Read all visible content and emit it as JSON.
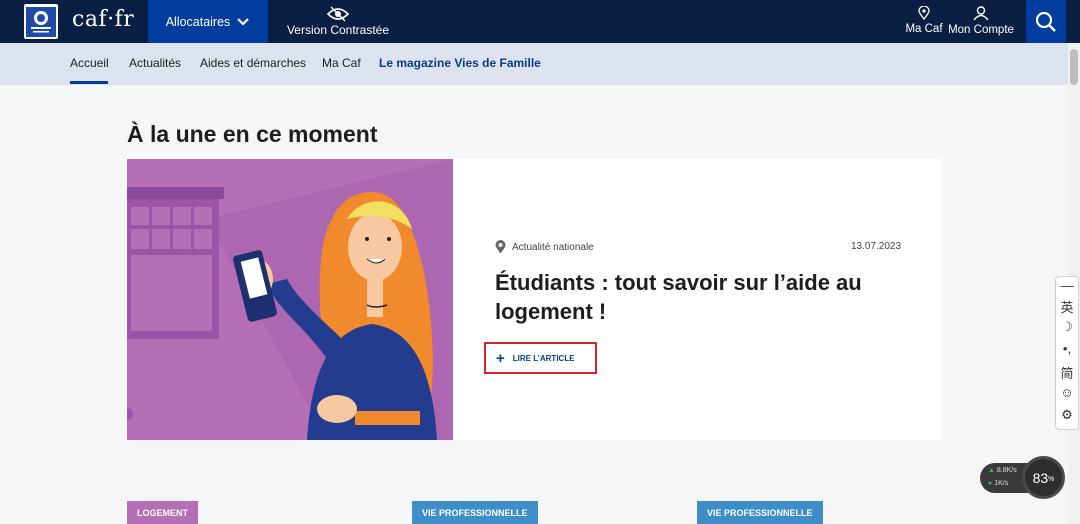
{
  "header": {
    "brand": "caf·fr",
    "allocataires_label": "Allocataires",
    "contrast_label": "Version Contrastée",
    "macaf_label": "Ma Caf",
    "compte_label": "Mon Compte"
  },
  "nav": {
    "items": [
      "Accueil",
      "Actualités",
      "Aides et démarches",
      "Ma Caf",
      "Le magazine Vies de Famille"
    ],
    "active": "Accueil"
  },
  "main": {
    "heading": "À la une en ce moment",
    "article": {
      "category": "Actualité nationale",
      "date": "13.07.2023",
      "title": "Étudiants : tout savoir sur l’aide au logement !",
      "read_more": "LIRE L’ARTICLE"
    },
    "tags": [
      "LOGEMENT",
      "VIE PROFESSIONNELLE",
      "VIE PROFESSIONNELLE"
    ]
  },
  "side_panel": {
    "items": [
      "—",
      "英",
      "☽",
      "•,",
      "简",
      "☺",
      "⚙"
    ]
  },
  "net_widget": {
    "up": "8.8K/s",
    "down": "1K/s",
    "percent": "83",
    "percent_unit": "%"
  },
  "colors": {
    "topbar": "#0a1f44",
    "primary_blue": "#003d9e",
    "nav_bg": "#dde3ed",
    "illustration_bg": "#b46fb6",
    "highlight_red": "#d8232a",
    "tag_blue": "#3e8fc9"
  }
}
